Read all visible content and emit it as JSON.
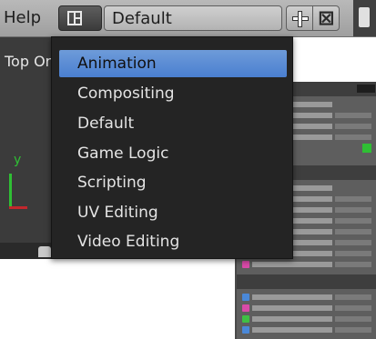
{
  "header": {
    "help_label": "Help",
    "layout_value": "Default",
    "add_icon": "plus-icon",
    "remove_glyph": "⊠"
  },
  "viewport": {
    "title": "Top Ortho",
    "axis_label": "y"
  },
  "menu": {
    "items": [
      {
        "label": "Animation",
        "active": true
      },
      {
        "label": "Compositing"
      },
      {
        "label": "Default"
      },
      {
        "label": "Game Logic"
      },
      {
        "label": "Scripting"
      },
      {
        "label": "UV Editing"
      },
      {
        "label": "Video Editing"
      }
    ],
    "active_color": "#5a8ad6"
  },
  "colors": {
    "axis_y": "#2fbf34",
    "axis_x": "#c2272d"
  }
}
